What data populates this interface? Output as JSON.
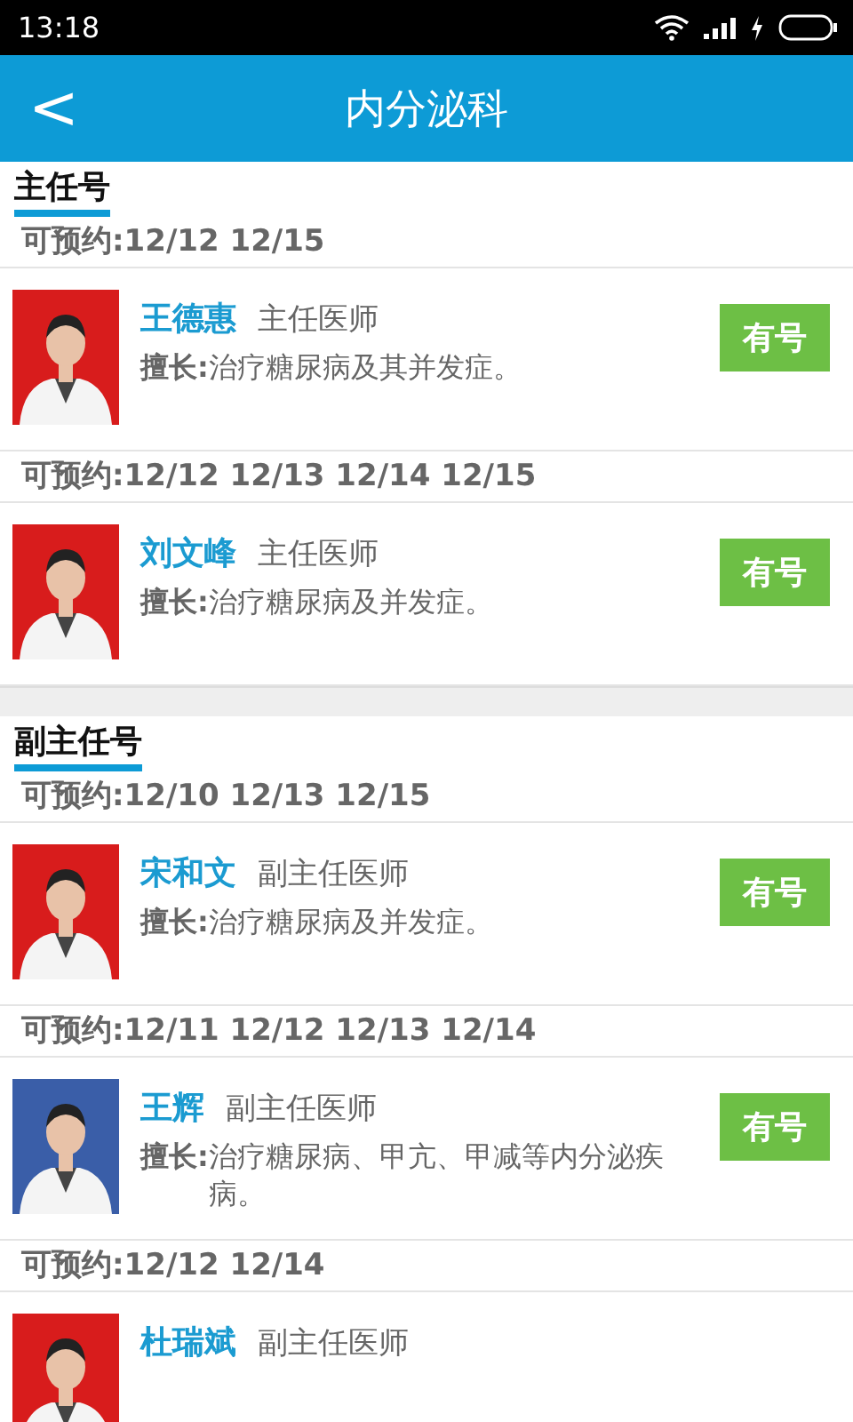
{
  "status_bar": {
    "time": "13:18"
  },
  "header": {
    "back": "<",
    "title": "内分泌科"
  },
  "sections": [
    {
      "title": "主任号",
      "groups": [
        {
          "dates": "可预约:12/12 12/15",
          "doctor": {
            "name": "王德惠",
            "rank": "主任医师",
            "specialty_label": "擅长:",
            "specialty": "治疗糖尿病及其并发症。",
            "button": "有号"
          }
        },
        {
          "dates": "可预约:12/12 12/13 12/14 12/15",
          "doctor": {
            "name": "刘文峰",
            "rank": "主任医师",
            "specialty_label": "擅长:",
            "specialty": "治疗糖尿病及并发症。",
            "button": "有号"
          }
        }
      ]
    },
    {
      "title": "副主任号",
      "groups": [
        {
          "dates": "可预约:12/10 12/13 12/15",
          "doctor": {
            "name": "宋和文",
            "rank": "副主任医师",
            "specialty_label": "擅长:",
            "specialty": "治疗糖尿病及并发症。",
            "button": "有号"
          }
        },
        {
          "dates": "可预约:12/11 12/12 12/13 12/14",
          "doctor": {
            "name": "王辉",
            "rank": "副主任医师",
            "specialty_label": "擅长:",
            "specialty": "治疗糖尿病、甲亢、甲减等内分泌疾病。",
            "button": "有号"
          }
        },
        {
          "dates": "可预约:12/12 12/14",
          "doctor": {
            "name": "杜瑞斌",
            "rank": "副主任医师"
          }
        }
      ]
    }
  ]
}
